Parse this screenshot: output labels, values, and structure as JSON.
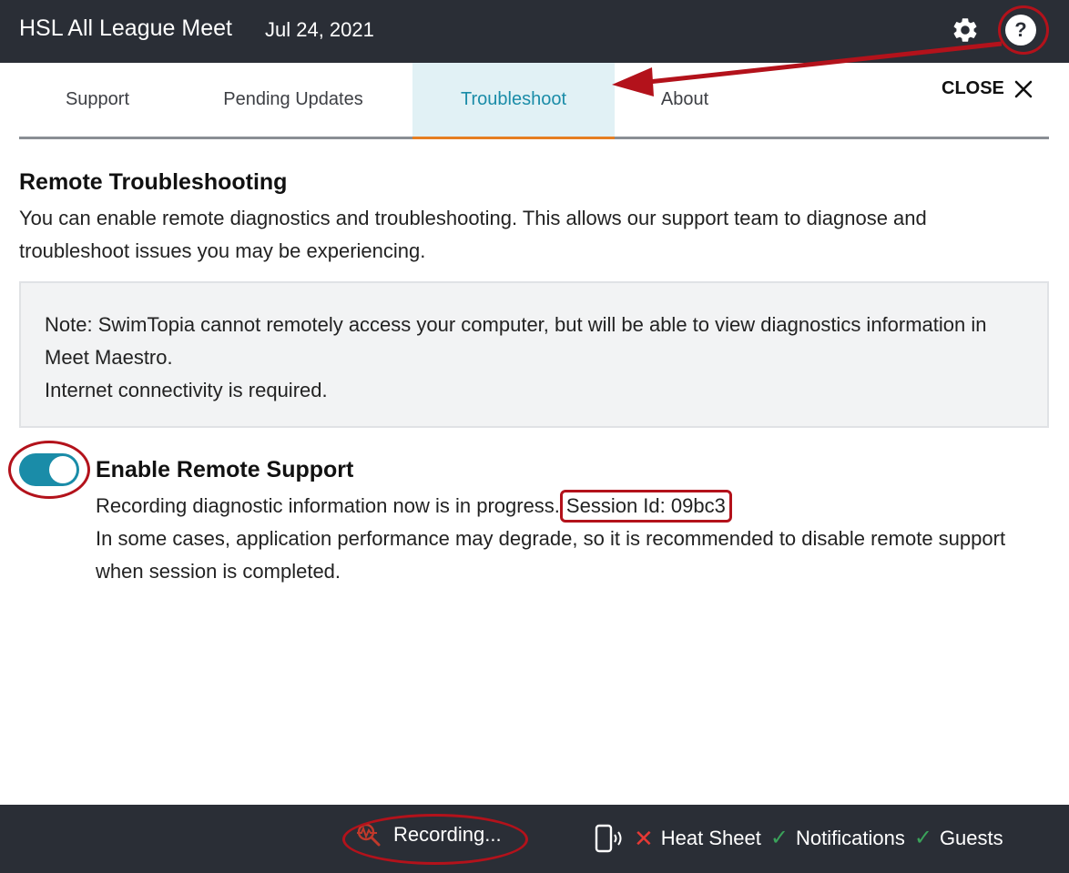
{
  "header": {
    "title": "HSL All League Meet",
    "date": "Jul 24, 2021",
    "settings_icon": "gear-icon",
    "help_icon": "question-circle-icon"
  },
  "tabs": [
    {
      "label": "Support",
      "active": false
    },
    {
      "label": "Pending Updates",
      "active": false
    },
    {
      "label": "Troubleshoot",
      "active": true
    },
    {
      "label": "About",
      "active": false
    }
  ],
  "close": {
    "label": "CLOSE",
    "icon": "close-icon"
  },
  "content": {
    "title": "Remote Troubleshooting",
    "intro": "You can enable remote diagnostics and troubleshooting. This allows our support team to diagnose and troubleshoot issues you may be experiencing.",
    "note_line1": "Note: SwimTopia cannot remotely access your computer, but will be able to view diagnostics information in Meet Maestro.",
    "note_line2": "Internet connectivity is required."
  },
  "remote_support": {
    "enabled": true,
    "title": "Enable Remote Support",
    "status_text": "Recording diagnostic information now is in progress.",
    "session_id": "Session Id: 09bc3",
    "warning": "In some cases, application performance may degrade, so it is recommended to disable remote support when session is completed."
  },
  "statusbar": {
    "recording_label": "Recording...",
    "recording_icon": "recording-magnifier-icon",
    "device_icon": "phone-signal-icon",
    "items": [
      {
        "label": "Heat Sheet",
        "state": "error"
      },
      {
        "label": "Notifications",
        "state": "ok"
      },
      {
        "label": "Guests",
        "state": "ok"
      }
    ]
  },
  "colors": {
    "header_bg": "#2a2e36",
    "accent": "#1a8ca8",
    "active_tab_bg": "#e1f1f5",
    "active_tab_underline": "#e67e22",
    "annotation_red": "#b3121b",
    "error": "#e53935",
    "ok": "#3aa35a"
  }
}
